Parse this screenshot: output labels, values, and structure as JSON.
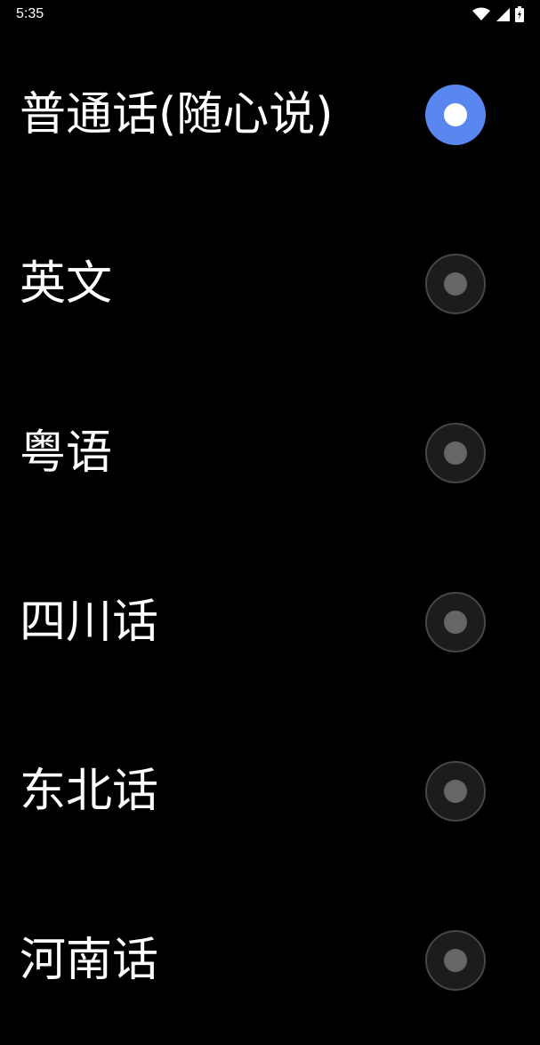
{
  "status_bar": {
    "time": "5:35",
    "icons": [
      "wifi-icon",
      "signal-icon",
      "battery-icon"
    ]
  },
  "dialects": [
    {
      "label": "普通话(随心说)",
      "selected": true
    },
    {
      "label": "英文",
      "selected": false
    },
    {
      "label": "粤语",
      "selected": false
    },
    {
      "label": "四川话",
      "selected": false
    },
    {
      "label": "东北话",
      "selected": false
    },
    {
      "label": "河南话",
      "selected": false
    }
  ],
  "colors": {
    "background": "#000000",
    "accent": "#5a86ef",
    "radio_off_fill": "#1c1c1c",
    "radio_off_dot": "#666666"
  }
}
